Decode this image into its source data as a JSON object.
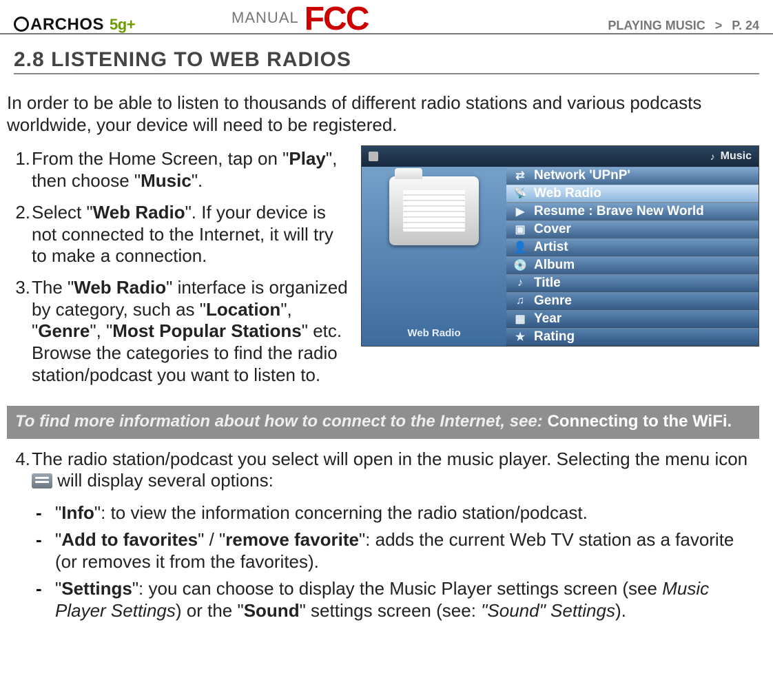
{
  "header": {
    "logo_text": "ARCHOS",
    "model": "5g+",
    "manual_label": "MANUAL",
    "fcc": "FCC",
    "section_name": "PLAYING MUSIC",
    "chevron": ">",
    "page_label": "P. 24"
  },
  "section": {
    "number": "2.8",
    "title": "LISTENING TO WEB RADIOS"
  },
  "intro": "In order to be able to listen to thousands of different radio stations and various podcasts worldwide, your device will need to be registered.",
  "steps": {
    "s1_num": "1.",
    "s1_a": "From the Home Screen, tap on \"",
    "s1_b": "Play",
    "s1_c": "\", then choose \"",
    "s1_d": "Music",
    "s1_e": "\".",
    "s2_num": "2.",
    "s2_a": "Select \"",
    "s2_b": "Web Radio",
    "s2_c": "\". If your device is not connected to the Internet, it will try to make a connection.",
    "s3_num": "3.",
    "s3_a": "The \"",
    "s3_b": "Web Radio",
    "s3_c": "\" interface is organized by category, such as \"",
    "s3_d": "Location",
    "s3_e": "\", \"",
    "s3_f": "Genre",
    "s3_g": "\", \"",
    "s3_h": "Most Popular Stations",
    "s3_i": "\" etc. Browse the categories to find the radio station/podcast you want to listen to."
  },
  "note": {
    "a": "To find more information about how to connect to the Internet, see: ",
    "b": "Connecting to the WiFi."
  },
  "step4": {
    "num": "4.",
    "a": "The radio station/podcast you select will open in the music player. Selecting the menu icon ",
    "b": " will display several options:"
  },
  "bullets": {
    "b1_a": "\"",
    "b1_b": "Info",
    "b1_c": "\": to view the information concerning the radio station/podcast.",
    "b2_a": "\"",
    "b2_b": "Add to favorites",
    "b2_c": "\" / \"",
    "b2_d": "remove favorite",
    "b2_e": "\": adds the current Web TV station as a favorite (or removes it from the favorites).",
    "b3_a": "\"",
    "b3_b": "Settings",
    "b3_c": "\": you can choose to display the Music Player settings screen (see ",
    "b3_d": "Music Player Settings",
    "b3_e": ") or the \"",
    "b3_f": "Sound",
    "b3_g": "\" settings screen (see: ",
    "b3_h": "\"Sound\" Settings",
    "b3_i": ")."
  },
  "screenshot": {
    "topbar_title": "Music",
    "left_label": "Web Radio",
    "items": [
      "Network 'UPnP'",
      "Web Radio",
      "Resume : Brave New World",
      "Cover",
      "Artist",
      "Album",
      "Title",
      "Genre",
      "Year",
      "Rating"
    ]
  }
}
